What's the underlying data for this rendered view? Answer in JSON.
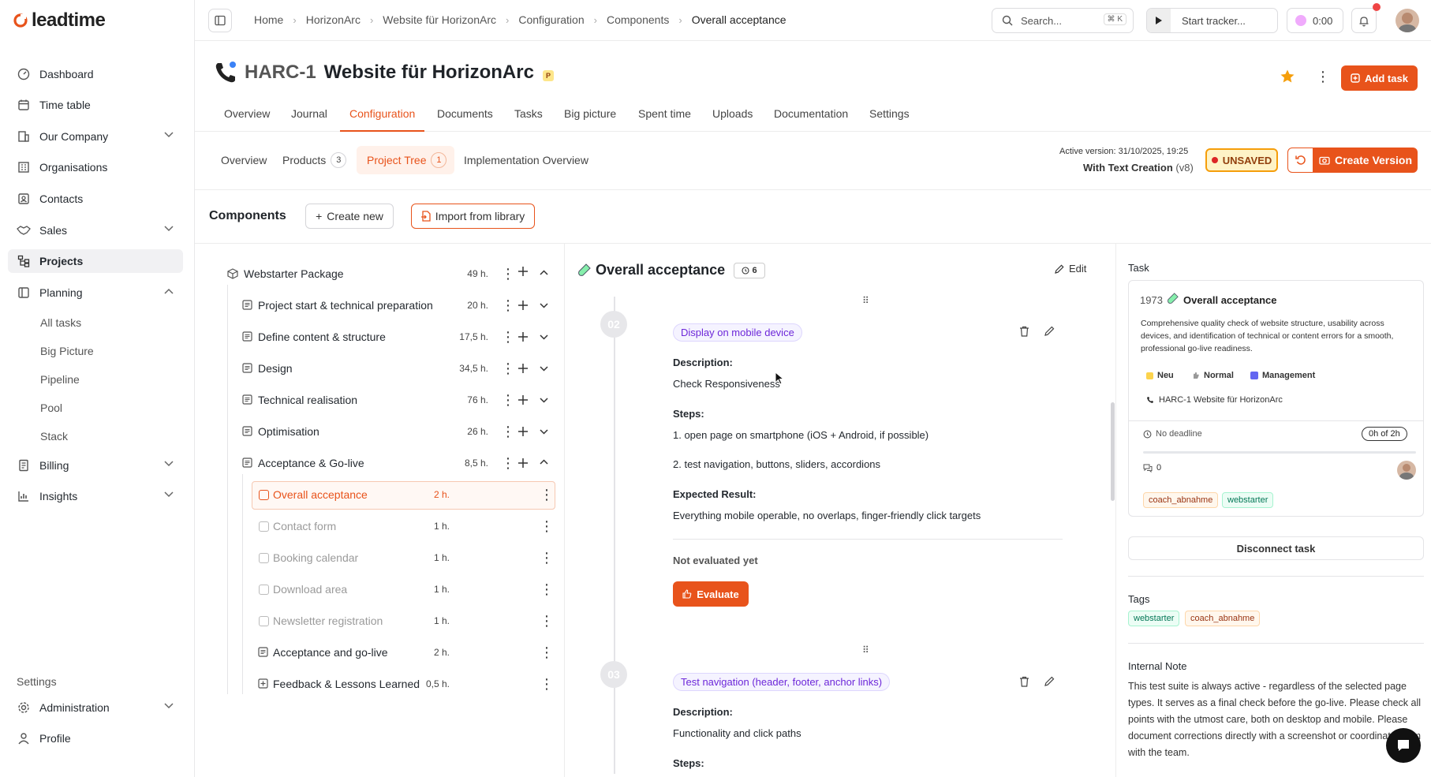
{
  "app": {
    "logo_text": "leadtime"
  },
  "sidebar": {
    "items": [
      {
        "label": "Dashboard",
        "icon": "dashboard-icon"
      },
      {
        "label": "Time table",
        "icon": "calendar-icon"
      },
      {
        "label": "Our Company",
        "icon": "building-icon"
      },
      {
        "label": "Organisations",
        "icon": "organisation-icon"
      },
      {
        "label": "Contacts",
        "icon": "contacts-icon"
      },
      {
        "label": "Sales",
        "icon": "handshake-icon"
      },
      {
        "label": "Projects",
        "icon": "projects-icon"
      },
      {
        "label": "Planning",
        "icon": "planning-icon"
      },
      {
        "label": "Billing",
        "icon": "billing-icon"
      },
      {
        "label": "Insights",
        "icon": "insights-icon"
      }
    ],
    "planning_sub": [
      "All tasks",
      "Big Picture",
      "Pipeline",
      "Pool",
      "Stack"
    ],
    "settings_label": "Settings",
    "administration": "Administration",
    "profile": "Profile"
  },
  "topbar": {
    "breadcrumb": [
      "Home",
      "HorizonArc",
      "Website für HorizonArc",
      "Configuration",
      "Components",
      "Overall acceptance"
    ],
    "search_placeholder": "Search...",
    "search_shortcut": "⌘ K",
    "tracker_label": "Start tracker...",
    "timer": "0:00"
  },
  "project": {
    "code": "HARC-1",
    "name": "Website für HorizonArc",
    "badge": "P",
    "add_task": "Add task"
  },
  "tabs": [
    "Overview",
    "Journal",
    "Configuration",
    "Documents",
    "Tasks",
    "Big picture",
    "Spent time",
    "Uploads",
    "Documentation",
    "Settings"
  ],
  "subtabs": {
    "overview": "Overview",
    "products": "Products",
    "products_count": "3",
    "project_tree": "Project Tree",
    "project_tree_count": "1",
    "implementation": "Implementation Overview"
  },
  "version": {
    "active_label": "Active version: 31/10/2025, 19:25",
    "name": "With Text Creation",
    "ver": "(v8)",
    "unsaved": "UNSAVED",
    "create": "Create Version"
  },
  "components": {
    "title": "Components",
    "create_new": "Create new",
    "import": "Import from library"
  },
  "tree": {
    "root": {
      "label": "Webstarter Package",
      "hours": "49 h."
    },
    "groups": [
      {
        "label": "Project start & technical preparation",
        "hours": "20 h."
      },
      {
        "label": "Define content & structure",
        "hours": "17,5 h."
      },
      {
        "label": "Design",
        "hours": "34,5 h."
      },
      {
        "label": "Technical realisation",
        "hours": "76 h."
      },
      {
        "label": "Optimisation",
        "hours": "26 h."
      },
      {
        "label": "Acceptance & Go-live",
        "hours": "8,5 h."
      }
    ],
    "children": [
      {
        "label": "Overall acceptance",
        "hours": "2 h."
      },
      {
        "label": "Contact form",
        "hours": "1 h."
      },
      {
        "label": "Booking calendar",
        "hours": "1 h."
      },
      {
        "label": "Download area",
        "hours": "1 h."
      },
      {
        "label": "Newsletter registration",
        "hours": "1 h."
      },
      {
        "label": "Acceptance and go-live",
        "hours": "2 h."
      },
      {
        "label": "Feedback & Lessons Learned",
        "hours": "0,5 h."
      }
    ]
  },
  "detail": {
    "title": "Overall acceptance",
    "count": "6",
    "edit": "Edit",
    "steps": [
      {
        "num": "02",
        "name": "Display on mobile device",
        "desc_label": "Description:",
        "desc": "Check Responsiveness",
        "steps_label": "Steps:",
        "step1": "1. open page on smartphone (iOS + Android, if possible)",
        "step2": "2. test navigation, buttons, sliders, accordions",
        "result_label": "Expected Result:",
        "result": "Everything mobile operable, no overlaps, finger-friendly click targets",
        "status": "Not evaluated yet",
        "evaluate": "Evaluate"
      },
      {
        "num": "03",
        "name": "Test navigation (header, footer, anchor links)",
        "desc_label": "Description:",
        "desc": "Functionality and click paths",
        "steps_label": "Steps:"
      }
    ]
  },
  "task": {
    "section": "Task",
    "id": "1973",
    "title": "Overall acceptance",
    "description": "Comprehensive quality check of website structure, usability across devices, and identification of technical or content errors for a smooth, professional go-live readiness.",
    "status": "Neu",
    "priority": "Normal",
    "type": "Management",
    "project": "HARC-1 Website für HorizonArc",
    "deadline": "No deadline",
    "time": "0h of 2h",
    "comments": "0",
    "tags": [
      "coach_abnahme",
      "webstarter"
    ],
    "disconnect": "Disconnect task"
  },
  "tags_section": {
    "label": "Tags",
    "tags": [
      "webstarter",
      "coach_abnahme"
    ]
  },
  "note": {
    "label": "Internal Note",
    "text": "This test suite is always active - regardless of the selected page types. It serves as a final check before the go-live. Please check all points with the utmost care, both on desktop and mobile. Please document corrections directly with a screenshot or coordinate them with the team."
  },
  "colors": {
    "accent": "#e8531b",
    "purple": "#6d28d9"
  }
}
